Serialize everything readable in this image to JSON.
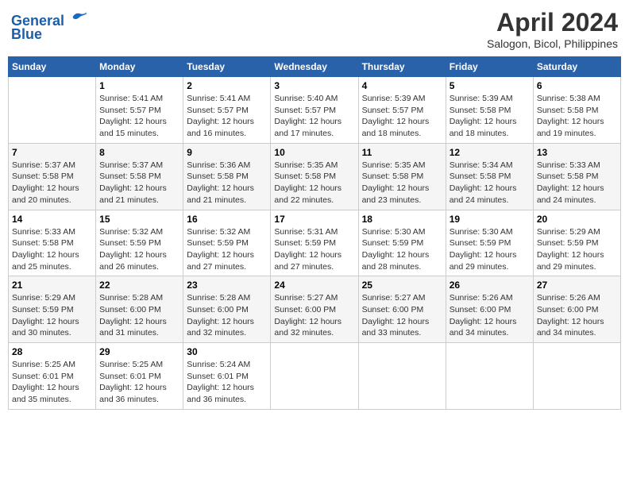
{
  "header": {
    "logo_line1": "General",
    "logo_line2": "Blue",
    "month_year": "April 2024",
    "location": "Salogon, Bicol, Philippines"
  },
  "weekdays": [
    "Sunday",
    "Monday",
    "Tuesday",
    "Wednesday",
    "Thursday",
    "Friday",
    "Saturday"
  ],
  "weeks": [
    [
      {
        "day": "",
        "info": ""
      },
      {
        "day": "1",
        "info": "Sunrise: 5:41 AM\nSunset: 5:57 PM\nDaylight: 12 hours\nand 15 minutes."
      },
      {
        "day": "2",
        "info": "Sunrise: 5:41 AM\nSunset: 5:57 PM\nDaylight: 12 hours\nand 16 minutes."
      },
      {
        "day": "3",
        "info": "Sunrise: 5:40 AM\nSunset: 5:57 PM\nDaylight: 12 hours\nand 17 minutes."
      },
      {
        "day": "4",
        "info": "Sunrise: 5:39 AM\nSunset: 5:57 PM\nDaylight: 12 hours\nand 18 minutes."
      },
      {
        "day": "5",
        "info": "Sunrise: 5:39 AM\nSunset: 5:58 PM\nDaylight: 12 hours\nand 18 minutes."
      },
      {
        "day": "6",
        "info": "Sunrise: 5:38 AM\nSunset: 5:58 PM\nDaylight: 12 hours\nand 19 minutes."
      }
    ],
    [
      {
        "day": "7",
        "info": "Sunrise: 5:37 AM\nSunset: 5:58 PM\nDaylight: 12 hours\nand 20 minutes."
      },
      {
        "day": "8",
        "info": "Sunrise: 5:37 AM\nSunset: 5:58 PM\nDaylight: 12 hours\nand 21 minutes."
      },
      {
        "day": "9",
        "info": "Sunrise: 5:36 AM\nSunset: 5:58 PM\nDaylight: 12 hours\nand 21 minutes."
      },
      {
        "day": "10",
        "info": "Sunrise: 5:35 AM\nSunset: 5:58 PM\nDaylight: 12 hours\nand 22 minutes."
      },
      {
        "day": "11",
        "info": "Sunrise: 5:35 AM\nSunset: 5:58 PM\nDaylight: 12 hours\nand 23 minutes."
      },
      {
        "day": "12",
        "info": "Sunrise: 5:34 AM\nSunset: 5:58 PM\nDaylight: 12 hours\nand 24 minutes."
      },
      {
        "day": "13",
        "info": "Sunrise: 5:33 AM\nSunset: 5:58 PM\nDaylight: 12 hours\nand 24 minutes."
      }
    ],
    [
      {
        "day": "14",
        "info": "Sunrise: 5:33 AM\nSunset: 5:58 PM\nDaylight: 12 hours\nand 25 minutes."
      },
      {
        "day": "15",
        "info": "Sunrise: 5:32 AM\nSunset: 5:59 PM\nDaylight: 12 hours\nand 26 minutes."
      },
      {
        "day": "16",
        "info": "Sunrise: 5:32 AM\nSunset: 5:59 PM\nDaylight: 12 hours\nand 27 minutes."
      },
      {
        "day": "17",
        "info": "Sunrise: 5:31 AM\nSunset: 5:59 PM\nDaylight: 12 hours\nand 27 minutes."
      },
      {
        "day": "18",
        "info": "Sunrise: 5:30 AM\nSunset: 5:59 PM\nDaylight: 12 hours\nand 28 minutes."
      },
      {
        "day": "19",
        "info": "Sunrise: 5:30 AM\nSunset: 5:59 PM\nDaylight: 12 hours\nand 29 minutes."
      },
      {
        "day": "20",
        "info": "Sunrise: 5:29 AM\nSunset: 5:59 PM\nDaylight: 12 hours\nand 29 minutes."
      }
    ],
    [
      {
        "day": "21",
        "info": "Sunrise: 5:29 AM\nSunset: 5:59 PM\nDaylight: 12 hours\nand 30 minutes."
      },
      {
        "day": "22",
        "info": "Sunrise: 5:28 AM\nSunset: 6:00 PM\nDaylight: 12 hours\nand 31 minutes."
      },
      {
        "day": "23",
        "info": "Sunrise: 5:28 AM\nSunset: 6:00 PM\nDaylight: 12 hours\nand 32 minutes."
      },
      {
        "day": "24",
        "info": "Sunrise: 5:27 AM\nSunset: 6:00 PM\nDaylight: 12 hours\nand 32 minutes."
      },
      {
        "day": "25",
        "info": "Sunrise: 5:27 AM\nSunset: 6:00 PM\nDaylight: 12 hours\nand 33 minutes."
      },
      {
        "day": "26",
        "info": "Sunrise: 5:26 AM\nSunset: 6:00 PM\nDaylight: 12 hours\nand 34 minutes."
      },
      {
        "day": "27",
        "info": "Sunrise: 5:26 AM\nSunset: 6:00 PM\nDaylight: 12 hours\nand 34 minutes."
      }
    ],
    [
      {
        "day": "28",
        "info": "Sunrise: 5:25 AM\nSunset: 6:01 PM\nDaylight: 12 hours\nand 35 minutes."
      },
      {
        "day": "29",
        "info": "Sunrise: 5:25 AM\nSunset: 6:01 PM\nDaylight: 12 hours\nand 36 minutes."
      },
      {
        "day": "30",
        "info": "Sunrise: 5:24 AM\nSunset: 6:01 PM\nDaylight: 12 hours\nand 36 minutes."
      },
      {
        "day": "",
        "info": ""
      },
      {
        "day": "",
        "info": ""
      },
      {
        "day": "",
        "info": ""
      },
      {
        "day": "",
        "info": ""
      }
    ]
  ]
}
